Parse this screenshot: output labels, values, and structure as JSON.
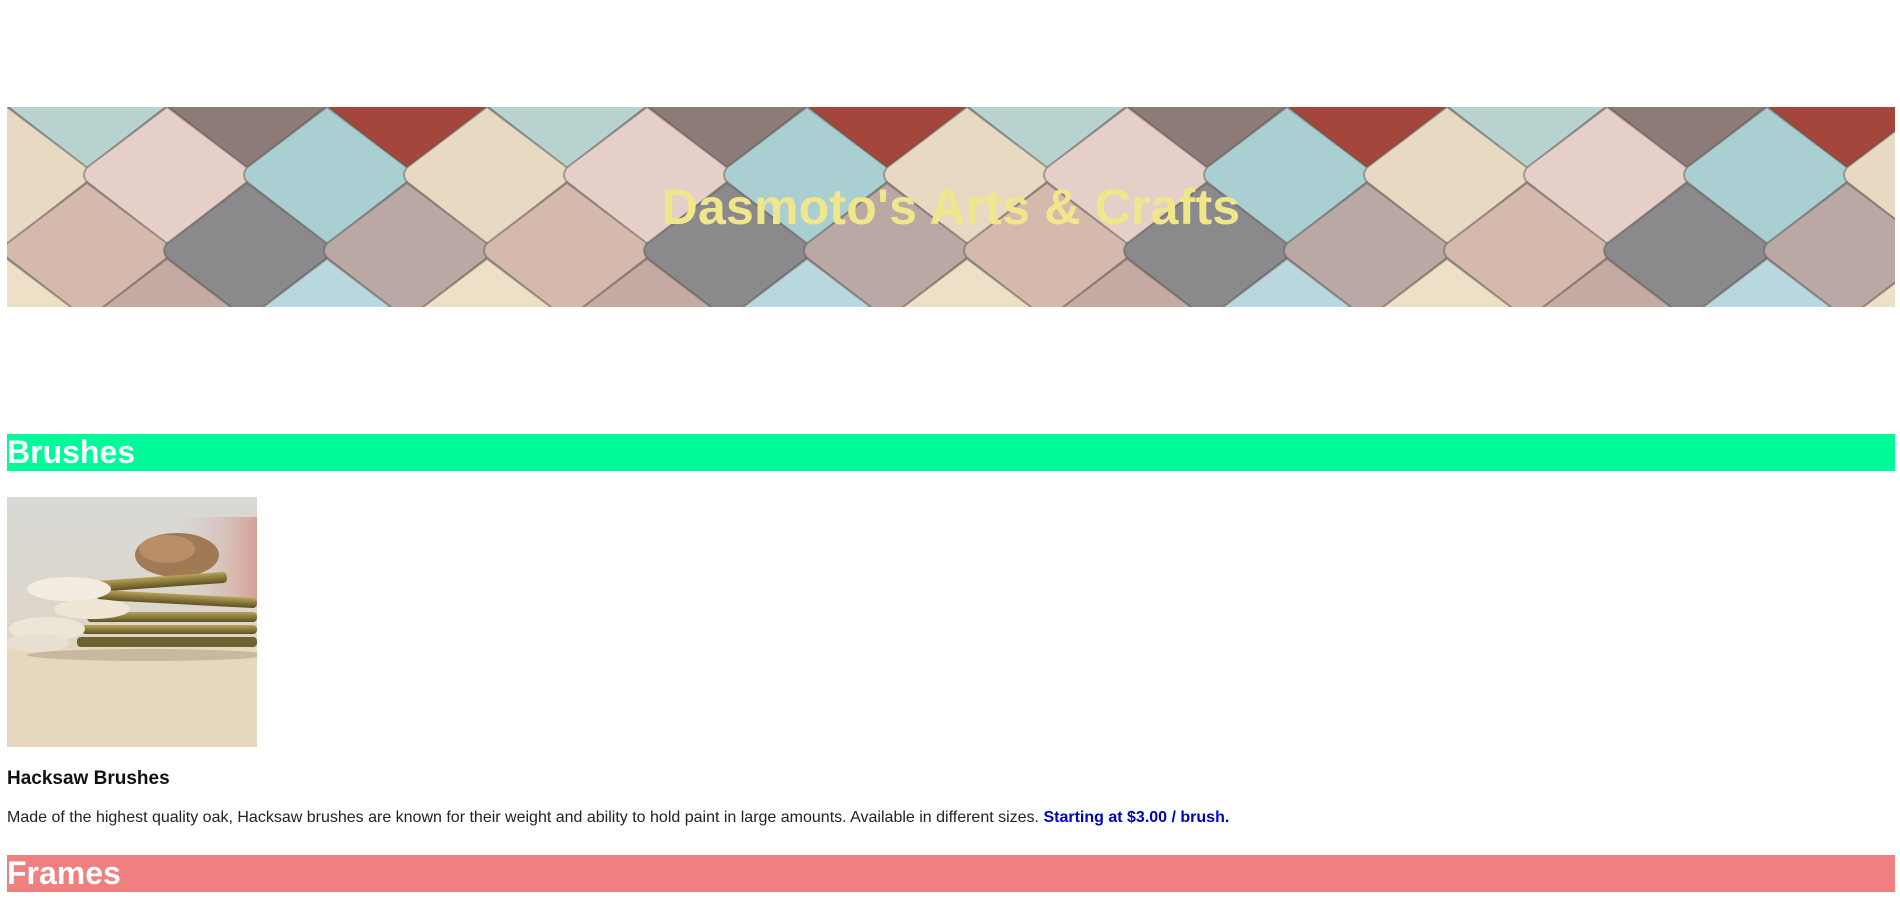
{
  "header": {
    "title": "Dasmoto's Arts & Crafts",
    "title_color": "#f0e68c",
    "background": "colorful-tiles-image"
  },
  "brushes": {
    "heading": "Brushes",
    "heading_bg": "#00fa9a",
    "product": {
      "image": "paint-brushes-photo",
      "name": "Hacksaw Brushes",
      "description": "Made of the highest quality oak, Hacksaw brushes are known for their weight and ability to hold paint in large amounts. Available in different sizes.",
      "price": "Starting at $3.00 / brush.",
      "price_color": "#0000cd"
    }
  },
  "frames": {
    "heading": "Frames",
    "heading_bg": "#f08080"
  }
}
